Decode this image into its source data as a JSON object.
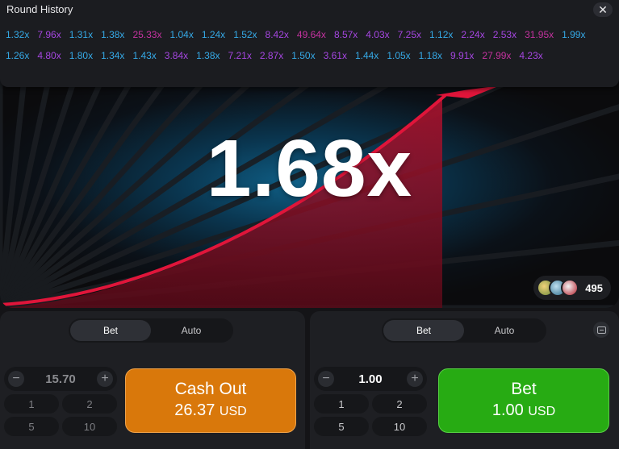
{
  "history": {
    "title": "Round History",
    "close_label": "✕",
    "values": [
      {
        "v": "1.32x",
        "c": "#35a9e6"
      },
      {
        "v": "7.96x",
        "c": "#a546e0"
      },
      {
        "v": "1.31x",
        "c": "#35a9e6"
      },
      {
        "v": "1.38x",
        "c": "#35a9e6"
      },
      {
        "v": "25.33x",
        "c": "#c4329f"
      },
      {
        "v": "1.04x",
        "c": "#35a9e6"
      },
      {
        "v": "1.24x",
        "c": "#35a9e6"
      },
      {
        "v": "1.52x",
        "c": "#35a9e6"
      },
      {
        "v": "8.42x",
        "c": "#a546e0"
      },
      {
        "v": "49.64x",
        "c": "#c4329f"
      },
      {
        "v": "8.57x",
        "c": "#a546e0"
      },
      {
        "v": "4.03x",
        "c": "#a546e0"
      },
      {
        "v": "7.25x",
        "c": "#a546e0"
      },
      {
        "v": "1.12x",
        "c": "#35a9e6"
      },
      {
        "v": "2.24x",
        "c": "#a546e0"
      },
      {
        "v": "2.53x",
        "c": "#a546e0"
      },
      {
        "v": "31.95x",
        "c": "#c4329f"
      },
      {
        "v": "1.99x",
        "c": "#35a9e6"
      },
      {
        "v": "1.26x",
        "c": "#35a9e6"
      },
      {
        "v": "4.80x",
        "c": "#a546e0"
      },
      {
        "v": "1.80x",
        "c": "#35a9e6"
      },
      {
        "v": "1.34x",
        "c": "#35a9e6"
      },
      {
        "v": "1.43x",
        "c": "#35a9e6"
      },
      {
        "v": "3.84x",
        "c": "#a546e0"
      },
      {
        "v": "1.38x",
        "c": "#35a9e6"
      },
      {
        "v": "7.21x",
        "c": "#a546e0"
      },
      {
        "v": "2.87x",
        "c": "#a546e0"
      },
      {
        "v": "1.50x",
        "c": "#35a9e6"
      },
      {
        "v": "3.61x",
        "c": "#a546e0"
      },
      {
        "v": "1.44x",
        "c": "#35a9e6"
      },
      {
        "v": "1.05x",
        "c": "#35a9e6"
      },
      {
        "v": "1.18x",
        "c": "#35a9e6"
      },
      {
        "v": "9.91x",
        "c": "#a546e0"
      },
      {
        "v": "27.99x",
        "c": "#c4329f"
      },
      {
        "v": "4.23x",
        "c": "#a546e0"
      }
    ]
  },
  "game": {
    "multiplier": "1.68x",
    "players_count": "495",
    "curve_color": "#e0153a",
    "fill_color": "#8a1027",
    "avatar_icons": [
      "avatar-icon",
      "avatar-icon",
      "avatar-icon"
    ]
  },
  "left_panel": {
    "tabs": [
      "Bet",
      "Auto"
    ],
    "active_tab": "Bet",
    "stake": "15.70",
    "minus_label": "−",
    "plus_label": "+",
    "quick_amounts": [
      "1",
      "2",
      "5",
      "10"
    ],
    "action_label": "Cash Out",
    "action_amount": "26.37",
    "currency": "USD",
    "action_color": "#d9780b"
  },
  "right_panel": {
    "tabs": [
      "Bet",
      "Auto"
    ],
    "active_tab": "Bet",
    "stake": "1.00",
    "minus_label": "−",
    "plus_label": "+",
    "quick_amounts": [
      "1",
      "2",
      "5",
      "10"
    ],
    "action_label": "Bet",
    "action_amount": "1.00",
    "currency": "USD",
    "action_color": "#27ab13"
  }
}
